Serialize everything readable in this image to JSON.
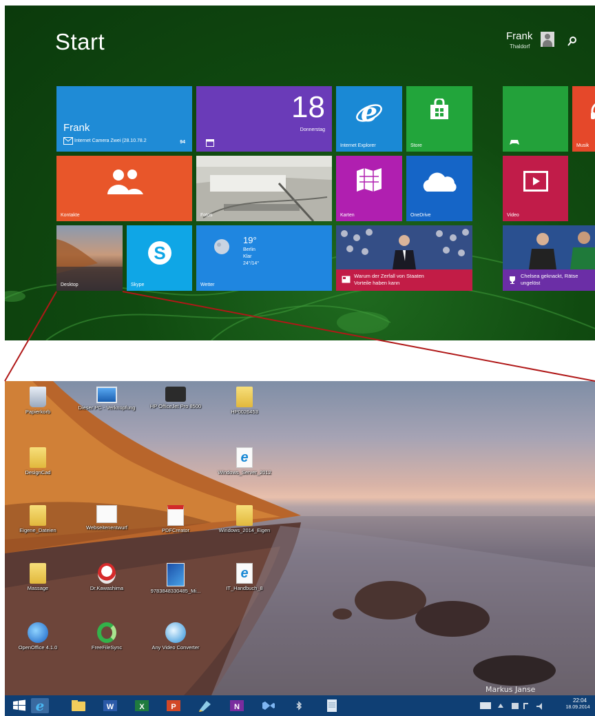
{
  "start": {
    "title": "Start",
    "user": {
      "name": "Frank",
      "subtitle": "Thaldorf"
    },
    "tiles": {
      "mail": {
        "name": "Frank",
        "subject": "Internet Camera Zwei (28.10.78.2",
        "count": "94"
      },
      "calendar": {
        "day": "18",
        "weekday": "Donnerstag"
      },
      "ie": {
        "label": "Internet Explorer"
      },
      "store": {
        "label": "Store"
      },
      "music": {
        "label": "Musik"
      },
      "contacts": {
        "label": "Kontakte"
      },
      "photos": {
        "label": "Fotos"
      },
      "maps": {
        "label": "Karten"
      },
      "onedrive": {
        "label": "OneDrive"
      },
      "video": {
        "label": "Video"
      },
      "desktop": {
        "label": "Desktop"
      },
      "skype": {
        "label": "Skype"
      },
      "weather": {
        "temp": "19°",
        "city": "Berlin",
        "condition": "Klar",
        "range": "24°/14°",
        "label": "Wetter"
      },
      "news": {
        "headline1": "Warum der Zerfall von Staaten",
        "headline2": "Vorteile haben kann"
      },
      "sport": {
        "headline1": "Chelsea geknackt, Rätse",
        "headline2": "ungelöst"
      }
    },
    "colors": {
      "background": "#0f4411",
      "accent_line": "#b01818"
    }
  },
  "desktop": {
    "icons": [
      {
        "label": "Papierkorb",
        "icon": "recycle-bin-icon"
      },
      {
        "label": "Dieser PC - Verknüpfung",
        "icon": "computer-icon"
      },
      {
        "label": "HP OfficeJet Pro 8500",
        "icon": "printer-icon"
      },
      {
        "label": "HP0026453",
        "icon": "folder-icon"
      },
      {
        "label": "DesignCad",
        "icon": "folder-icon"
      },
      {
        "label": "Windows_Server_2012",
        "icon": "ie-shortcut-icon"
      },
      {
        "label": "Eigene_Dateien",
        "icon": "folder-icon"
      },
      {
        "label": "Webseitenentwurf",
        "icon": "document-icon"
      },
      {
        "label": "PDFCreator",
        "icon": "pdf-icon"
      },
      {
        "label": "Windows_2014_Eigen",
        "icon": "folder-icon"
      },
      {
        "label": "Massage",
        "icon": "folder-icon"
      },
      {
        "label": "Dr.Kawashima",
        "icon": "app-icon"
      },
      {
        "label": "9783848330485_Mi...",
        "icon": "book-icon"
      },
      {
        "label": "IT_Handbuch_8",
        "icon": "ie-shortcut-icon"
      },
      {
        "label": "OpenOffice 4.1.0",
        "icon": "openoffice-icon"
      },
      {
        "label": "FreeFileSync",
        "icon": "sync-icon"
      },
      {
        "label": "Any Video Converter",
        "icon": "video-converter-icon"
      }
    ],
    "signature": "Markus Janse"
  },
  "taskbar": {
    "apps": [
      "windows-logo-icon",
      "ie-icon",
      "explorer-icon",
      "word-icon",
      "excel-icon",
      "powerpoint-icon",
      "paint-icon",
      "onenote-icon",
      "visual-studio-icon",
      "bluetooth-icon",
      "notepad-icon"
    ],
    "clock": {
      "time": "22:04",
      "date": "18.09.2014"
    }
  }
}
